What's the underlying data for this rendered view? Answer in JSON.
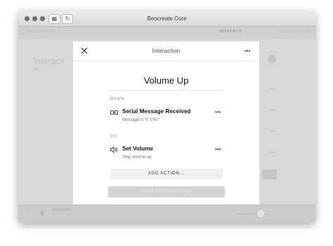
{
  "window": {
    "title": "Beocreate Core",
    "toolbar": {
      "grid_icon": "grid-icon",
      "reload_icon": "reload-icon"
    }
  },
  "app": {
    "nav_tabs": [
      {
        "label": "BEOCREATE",
        "active": false
      },
      {
        "label": "INTERACT",
        "active": true
      },
      {
        "label": "INTERACTION",
        "active": false
      }
    ],
    "background_title": "Interact",
    "player": {
      "product_name": "Superstar"
    }
  },
  "dialog": {
    "header_title": "Interaction",
    "close_icon": "close-icon",
    "more_icon": "more-icon",
    "interaction_name": "Volume Up",
    "when_label": "WHEN",
    "trigger": {
      "icon": "serial-connection-icon",
      "title": "Serial Message Received",
      "subtitle": "Message is '0\"1\"60'"
    },
    "do_label": "DO",
    "action": {
      "icon": "speaker-volume-icon",
      "title": "Set Volume",
      "subtitle": "Step volume up"
    },
    "add_action_label": "ADD ACTION...",
    "save_label": "SAVE INTERACTION"
  },
  "colors": {
    "overlay_background": "#d9d9d9",
    "dialog_background": "#ffffff",
    "save_disabled": "#d3d3d3",
    "add_button_background": "#f0f0f0"
  }
}
